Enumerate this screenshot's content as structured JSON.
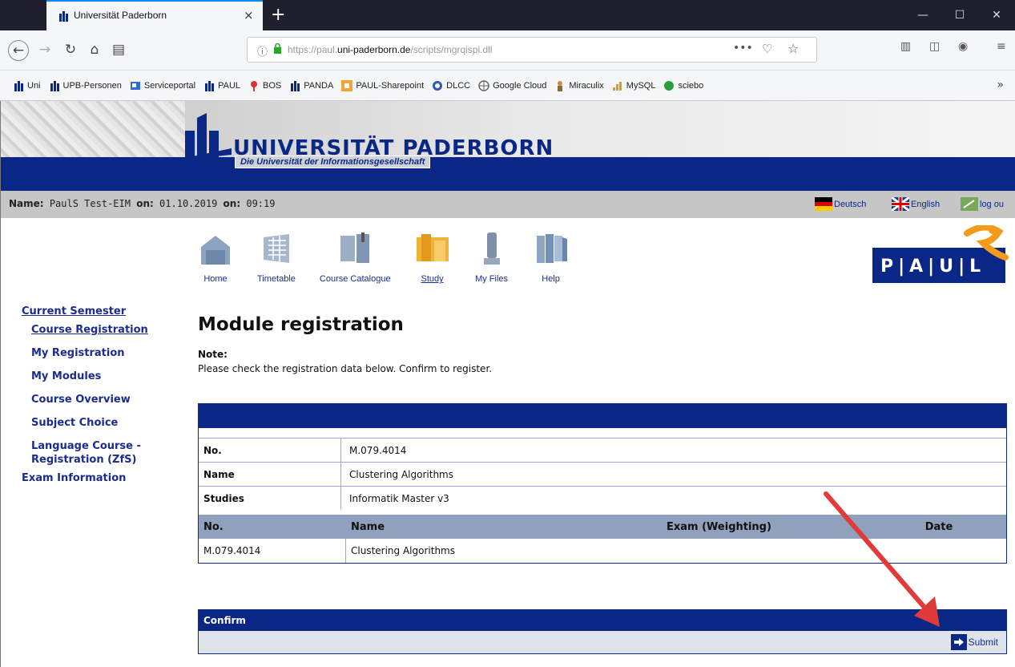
{
  "browser": {
    "tab_title": "Universität Paderborn",
    "tab_close": "×",
    "new_tab": "+",
    "window_controls": [
      "—",
      "☐",
      "✕"
    ],
    "url_host": "https://paul.",
    "url_domain": "uni-paderborn.de",
    "url_path": "/scripts/mgrqispi.dll",
    "url_actions": "•••",
    "bookmarks": [
      "Uni",
      "UPB-Personen",
      "Serviceportal",
      "PAUL",
      "BOS",
      "PANDA",
      "PAUL-Sharepoint",
      "DLCC",
      "Google Cloud",
      "Miraculix",
      "MySQL",
      "sciebo"
    ],
    "bookmarks_more": "»"
  },
  "header": {
    "university_name": "UNIVERSITÄT PADERBORN",
    "university_subtitle": "Die Universität der Informationsgesellschaft",
    "colors": {
      "brand_blue": "#0b2785",
      "header_gray": "#c6c6c6"
    }
  },
  "infobar": {
    "name_label": "Name:",
    "name_value": "PaulS Test-EIM",
    "on_label1": "on:",
    "date": "01.10.2019",
    "on_label2": "on:",
    "time": "09:19",
    "lang_de": "Deutsch",
    "lang_en": "English",
    "logout": "log ou"
  },
  "mainnav": {
    "items": [
      {
        "label": "Home",
        "icon": "home-icon"
      },
      {
        "label": "Timetable",
        "icon": "timetable-icon"
      },
      {
        "label": "Course Catalogue",
        "icon": "catalogue-icon"
      },
      {
        "label": "Study",
        "icon": "study-icon",
        "active": true
      },
      {
        "label": "My Files",
        "icon": "files-icon"
      },
      {
        "label": "Help",
        "icon": "help-icon"
      }
    ]
  },
  "sidebar": {
    "current_semester": "Current Semester",
    "items": [
      "Course Registration",
      "My Registration",
      "My Modules",
      "Course Overview",
      "Subject Choice",
      "Language Course - Registration (ZfS)"
    ],
    "exam_information": "Exam Information"
  },
  "main": {
    "title": "Module registration",
    "note_label": "Note:",
    "note_text": "Please check the registration data below. Confirm to register.",
    "details": [
      {
        "key": "No.",
        "value": "M.079.4014"
      },
      {
        "key": "Name",
        "value": "Clustering Algorithms"
      },
      {
        "key": "Studies",
        "value": "Informatik Master v3"
      }
    ],
    "table_headers": [
      "No.",
      "Name",
      "Exam  (Weighting)",
      "Date"
    ],
    "table_rows": [
      [
        "M.079.4014",
        "Clustering Algorithms",
        "",
        ""
      ]
    ],
    "confirm_label": "Confirm",
    "submit_label": "Submit"
  }
}
